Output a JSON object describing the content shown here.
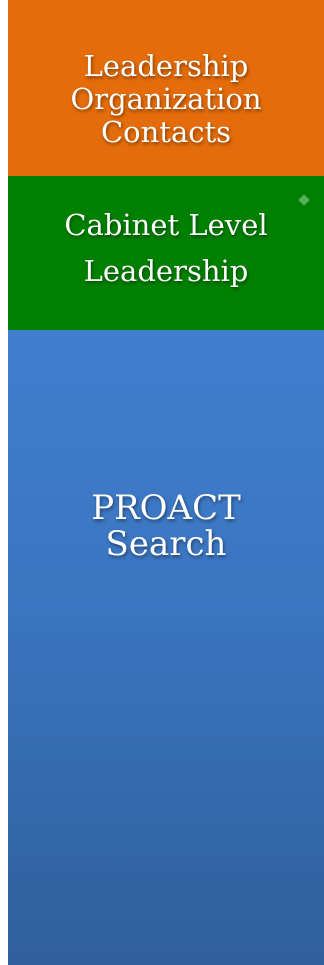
{
  "tiles": [
    {
      "lines": [
        "Leadership",
        "Organization",
        "Contacts"
      ],
      "color": "#e46c0a"
    },
    {
      "lines": [
        "Cabinet Level",
        "Leadership"
      ],
      "color": "#008000"
    },
    {
      "lines": [
        "PROACT",
        "Search"
      ],
      "color": "#3b74bf"
    }
  ]
}
